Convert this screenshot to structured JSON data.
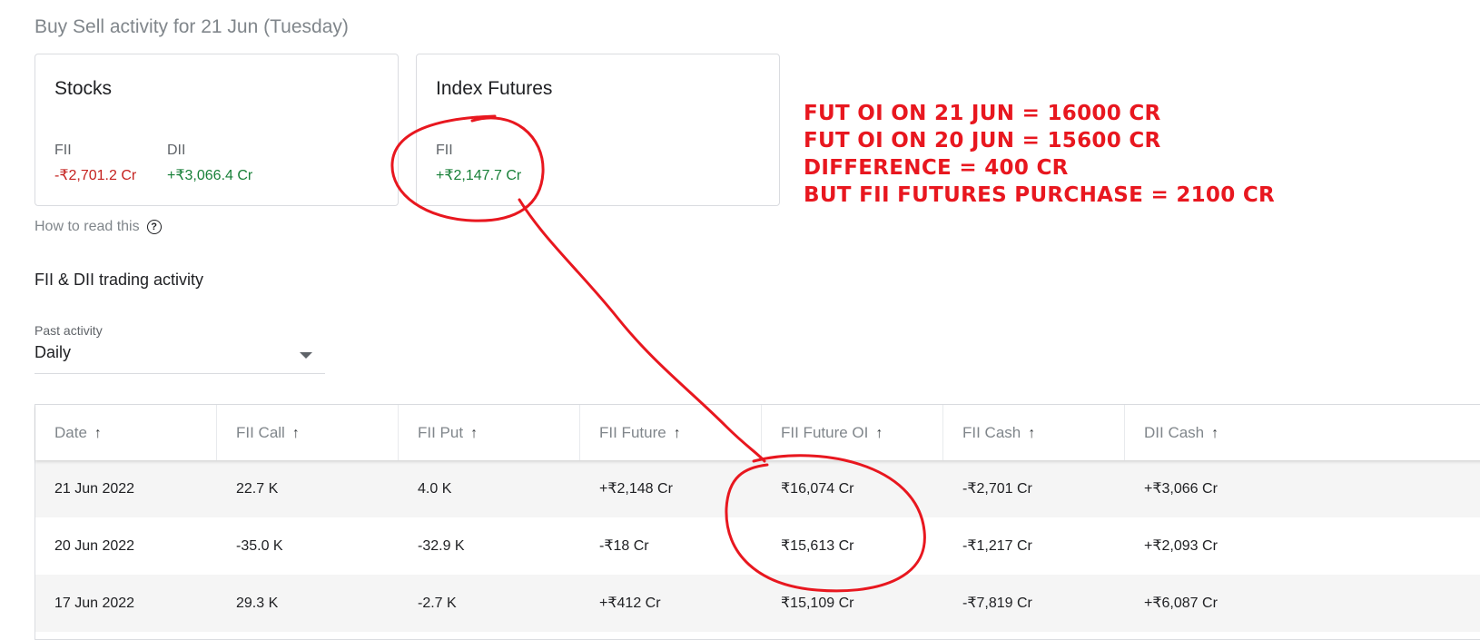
{
  "heading": "Buy Sell activity for 21 Jun (Tuesday)",
  "cards": {
    "stocks": {
      "title": "Stocks",
      "fii_label": "FII",
      "fii_value": "-₹2,701.2 Cr",
      "dii_label": "DII",
      "dii_value": "+₹3,066.4 Cr"
    },
    "index_futures": {
      "title": "Index Futures",
      "fii_label": "FII",
      "fii_value": "+₹2,147.7 Cr"
    }
  },
  "how_to_read": "How to read this",
  "help_icon": "?",
  "section_title": "FII & DII trading activity",
  "filter": {
    "label": "Past activity",
    "value": "Daily"
  },
  "table": {
    "sort_icon": "↑",
    "columns": [
      "Date",
      "FII Call",
      "FII Put",
      "FII Future",
      "FII Future OI",
      "FII Cash",
      "DII Cash"
    ],
    "rows": [
      [
        "21 Jun 2022",
        "22.7 K",
        "4.0 K",
        "+₹2,148 Cr",
        "₹16,074 Cr",
        "-₹2,701 Cr",
        "+₹3,066 Cr"
      ],
      [
        "20 Jun 2022",
        "-35.0 K",
        "-32.9 K",
        "-₹18 Cr",
        "₹15,613 Cr",
        "-₹1,217 Cr",
        "+₹2,093 Cr"
      ],
      [
        "17 Jun 2022",
        "29.3 K",
        "-2.7 K",
        "+₹412 Cr",
        "₹15,109 Cr",
        "-₹7,819 Cr",
        "+₹6,087 Cr"
      ]
    ]
  },
  "annotation": {
    "lines": [
      "FUT OI ON 21 JUN = 16000 CR",
      "FUT OI ON 20 JUN = 15600 CR",
      "DIFFERENCE = 400 CR",
      "BUT FII FUTURES PURCHASE = 2100 CR"
    ],
    "color": "#e8171f"
  },
  "colors": {
    "negative": "#c5221f",
    "positive": "#188038",
    "muted": "#80868b"
  }
}
